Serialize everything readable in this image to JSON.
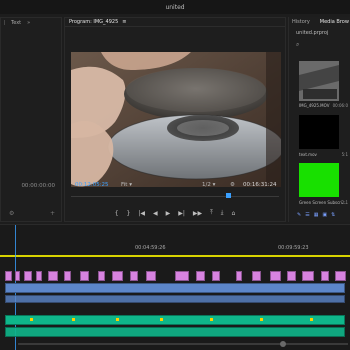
{
  "window": {
    "title": "united"
  },
  "left_panel": {
    "tabs": [
      "Text"
    ],
    "timecode": "00:00:00:00",
    "icons": [
      "wrench-icon",
      "plus-icon"
    ]
  },
  "program": {
    "title": "Program: IMG_4925",
    "timecode_left": "00:12:05:25",
    "fit_label": "Fit",
    "resolution_label": "1/2",
    "timecode_right": "00:16:31:24",
    "transport_icons": [
      "mark-in-icon",
      "mark-out-icon",
      "go-to-in-icon",
      "step-back-icon",
      "play-icon",
      "step-forward-icon",
      "go-to-out-icon",
      "lift-icon",
      "extract-icon",
      "export-frame-icon"
    ]
  },
  "right_panel": {
    "tabs": [
      "History",
      "Media Brow"
    ],
    "project_name": "united.prproj",
    "items": [
      {
        "name": "IMG_4925.MOV",
        "meta": "00:06:0"
      },
      {
        "name": "text.mov",
        "meta": "5:1"
      },
      {
        "name": "Green Screen Subscri...",
        "meta": "2:1"
      }
    ]
  },
  "timeline": {
    "timecodes": [
      "00:04:59:26",
      "00:09:59:23"
    ]
  },
  "colors": {
    "accent_blue": "#3aa0ff",
    "clip_pink": "#d783e0",
    "clip_blue": "#5c86c9",
    "clip_teal": "#0fb68a",
    "work_area_yellow": "#d8d300"
  }
}
